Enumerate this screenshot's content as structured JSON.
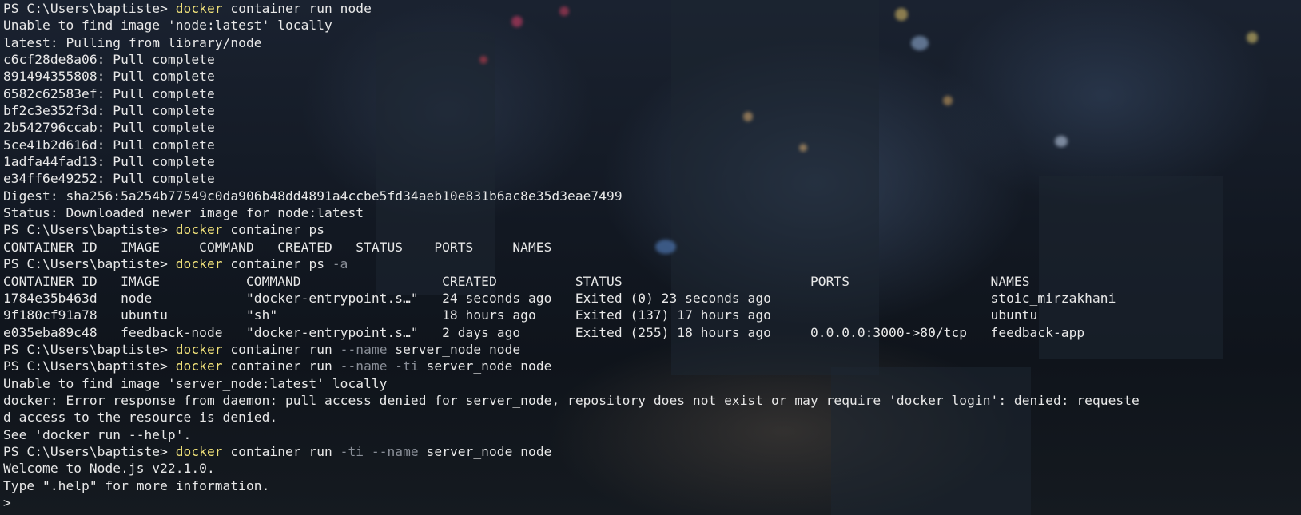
{
  "terminal": {
    "colors": {
      "text": "#e8e8e8",
      "command": "#f1e27a",
      "flag": "#8a8f98"
    },
    "lines": [
      [
        {
          "t": "PS C:\\Users\\baptiste> "
        },
        {
          "t": "docker",
          "c": "cmd"
        },
        {
          "t": " container run node"
        }
      ],
      [
        {
          "t": "Unable to find image 'node:latest' locally"
        }
      ],
      [
        {
          "t": "latest: Pulling from library/node"
        }
      ],
      [
        {
          "t": "c6cf28de8a06: Pull complete"
        }
      ],
      [
        {
          "t": "891494355808: Pull complete"
        }
      ],
      [
        {
          "t": "6582c62583ef: Pull complete"
        }
      ],
      [
        {
          "t": "bf2c3e352f3d: Pull complete"
        }
      ],
      [
        {
          "t": "2b542796ccab: Pull complete"
        }
      ],
      [
        {
          "t": "5ce41b2d616d: Pull complete"
        }
      ],
      [
        {
          "t": "1adfa44fad13: Pull complete"
        }
      ],
      [
        {
          "t": "e34ff6e49252: Pull complete"
        }
      ],
      [
        {
          "t": "Digest: sha256:5a254b77549c0da906b48dd4891a4ccbe5fd34aeb10e831b6ac8e35d3eae7499"
        }
      ],
      [
        {
          "t": "Status: Downloaded newer image for node:latest"
        }
      ],
      [
        {
          "t": "PS C:\\Users\\baptiste> "
        },
        {
          "t": "docker",
          "c": "cmd"
        },
        {
          "t": " container ps"
        }
      ],
      [
        {
          "t": "CONTAINER ID   IMAGE     COMMAND   CREATED   STATUS    PORTS     NAMES"
        }
      ],
      [
        {
          "t": "PS C:\\Users\\baptiste> "
        },
        {
          "t": "docker",
          "c": "cmd"
        },
        {
          "t": " container ps "
        },
        {
          "t": "-a",
          "c": "flag"
        }
      ],
      [
        {
          "t": "CONTAINER ID   IMAGE           COMMAND                  CREATED          STATUS                        PORTS                  NAMES"
        }
      ],
      [
        {
          "t": "1784e35b463d   node            \"docker-entrypoint.s…\"   24 seconds ago   Exited (0) 23 seconds ago                            stoic_mirzakhani"
        }
      ],
      [
        {
          "t": "9f180cf91a78   ubuntu          \"sh\"                     18 hours ago     Exited (137) 17 hours ago                            ubuntu"
        }
      ],
      [
        {
          "t": "e035eba89c48   feedback-node   \"docker-entrypoint.s…\"   2 days ago       Exited (255) 18 hours ago     0.0.0.0:3000->80/tcp   feedback-app"
        }
      ],
      [
        {
          "t": "PS C:\\Users\\baptiste> "
        },
        {
          "t": "docker",
          "c": "cmd"
        },
        {
          "t": " container run "
        },
        {
          "t": "--name",
          "c": "flag"
        },
        {
          "t": " server_node node"
        }
      ],
      [
        {
          "t": "PS C:\\Users\\baptiste> "
        },
        {
          "t": "docker",
          "c": "cmd"
        },
        {
          "t": " container run "
        },
        {
          "t": "--name -ti",
          "c": "flag"
        },
        {
          "t": " server_node node"
        }
      ],
      [
        {
          "t": "Unable to find image 'server_node:latest' locally"
        }
      ],
      [
        {
          "t": "docker: Error response from daemon: pull access denied for server_node, repository does not exist or may require 'docker login': denied: requeste"
        }
      ],
      [
        {
          "t": "d access to the resource is denied."
        }
      ],
      [
        {
          "t": "See 'docker run --help'."
        }
      ],
      [
        {
          "t": "PS C:\\Users\\baptiste> "
        },
        {
          "t": "docker",
          "c": "cmd"
        },
        {
          "t": " container run "
        },
        {
          "t": "-ti --name",
          "c": "flag"
        },
        {
          "t": " server_node node"
        }
      ],
      [
        {
          "t": "Welcome to Node.js v22.1.0."
        }
      ],
      [
        {
          "t": "Type \".help\" for more information."
        }
      ],
      [
        {
          "t": "> ",
          "c": "cursor"
        }
      ]
    ]
  }
}
